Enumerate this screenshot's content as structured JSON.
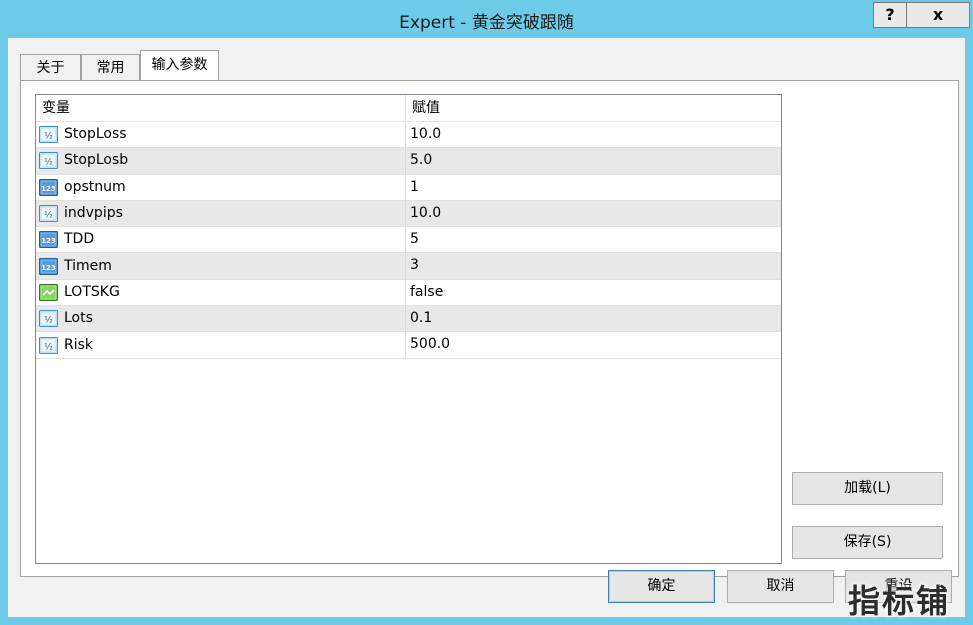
{
  "window": {
    "title": "Expert - 黄金突破跟随",
    "help_label": "?",
    "close_label": "x"
  },
  "tabs": [
    {
      "label": "关于",
      "active": false
    },
    {
      "label": "常用",
      "active": false
    },
    {
      "label": "输入参数",
      "active": true
    }
  ],
  "grid": {
    "columns": [
      "变量",
      "赋值"
    ],
    "rows": [
      {
        "type_icon": "double-icon",
        "name": "StopLoss",
        "value": "10.0"
      },
      {
        "type_icon": "double-icon",
        "name": "StopLosb",
        "value": "5.0"
      },
      {
        "type_icon": "integer-icon",
        "name": "opstnum",
        "value": "1"
      },
      {
        "type_icon": "double-icon",
        "name": "indvpips",
        "value": "10.0"
      },
      {
        "type_icon": "integer-icon",
        "name": "TDD",
        "value": "5"
      },
      {
        "type_icon": "integer-icon",
        "name": "Timem",
        "value": "3"
      },
      {
        "type_icon": "bool-icon",
        "name": "LOTSKG",
        "value": "false"
      },
      {
        "type_icon": "double-icon",
        "name": "Lots",
        "value": "0.1"
      },
      {
        "type_icon": "double-icon",
        "name": "Risk",
        "value": "500.0"
      }
    ]
  },
  "buttons": {
    "load": "加载(L)",
    "save": "保存(S)",
    "ok": "确定",
    "cancel": "取消",
    "reset": "重设"
  },
  "watermark": "指标铺"
}
